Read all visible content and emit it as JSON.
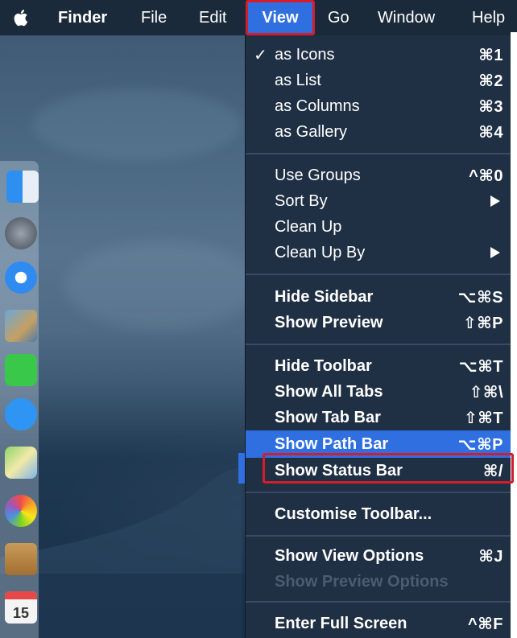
{
  "menubar": {
    "apple_icon": "apple-logo-icon",
    "items": [
      "Finder",
      "File",
      "Edit",
      "View",
      "Go",
      "Window",
      "Help"
    ]
  },
  "dock": {
    "icons": [
      "finder-icon",
      "launchpad-icon",
      "safari-icon",
      "photo-app-icon",
      "facetime-icon",
      "messages-icon",
      "maps-icon",
      "photos-icon",
      "notes-icon",
      "calendar-icon"
    ],
    "calendar_day": "15"
  },
  "view_menu": {
    "items": [
      {
        "label": "as Icons",
        "shortcut": "⌘1",
        "checked": true
      },
      {
        "label": "as List",
        "shortcut": "⌘2"
      },
      {
        "label": "as Columns",
        "shortcut": "⌘3"
      },
      {
        "label": "as Gallery",
        "shortcut": "⌘4"
      },
      {
        "label": "Use Groups",
        "shortcut": "^⌘0"
      },
      {
        "label": "Sort By",
        "submenu": true
      },
      {
        "label": "Clean Up"
      },
      {
        "label": "Clean Up By",
        "submenu": true
      },
      {
        "label": "Hide Sidebar",
        "shortcut": "⌥⌘S"
      },
      {
        "label": "Show Preview",
        "shortcut": "⇧⌘P"
      },
      {
        "label": "Hide Toolbar",
        "shortcut": "⌥⌘T"
      },
      {
        "label": "Show All Tabs",
        "shortcut": "⇧⌘\\"
      },
      {
        "label": "Show Tab Bar",
        "shortcut": "⇧⌘T"
      },
      {
        "label": "Show Path Bar",
        "shortcut": "⌥⌘P",
        "highlighted": true
      },
      {
        "label": "Show Status Bar",
        "shortcut": "⌘/"
      },
      {
        "label": "Customise Toolbar..."
      },
      {
        "label": "Show View Options",
        "shortcut": "⌘J"
      },
      {
        "label": "Show Preview Options",
        "disabled": true
      },
      {
        "label": "Enter Full Screen",
        "shortcut": "^⌘F"
      }
    ]
  },
  "colors": {
    "highlight": "#2f6fe0",
    "annotation_red": "#d21d2c",
    "menu_bg": "#1f2f44"
  }
}
